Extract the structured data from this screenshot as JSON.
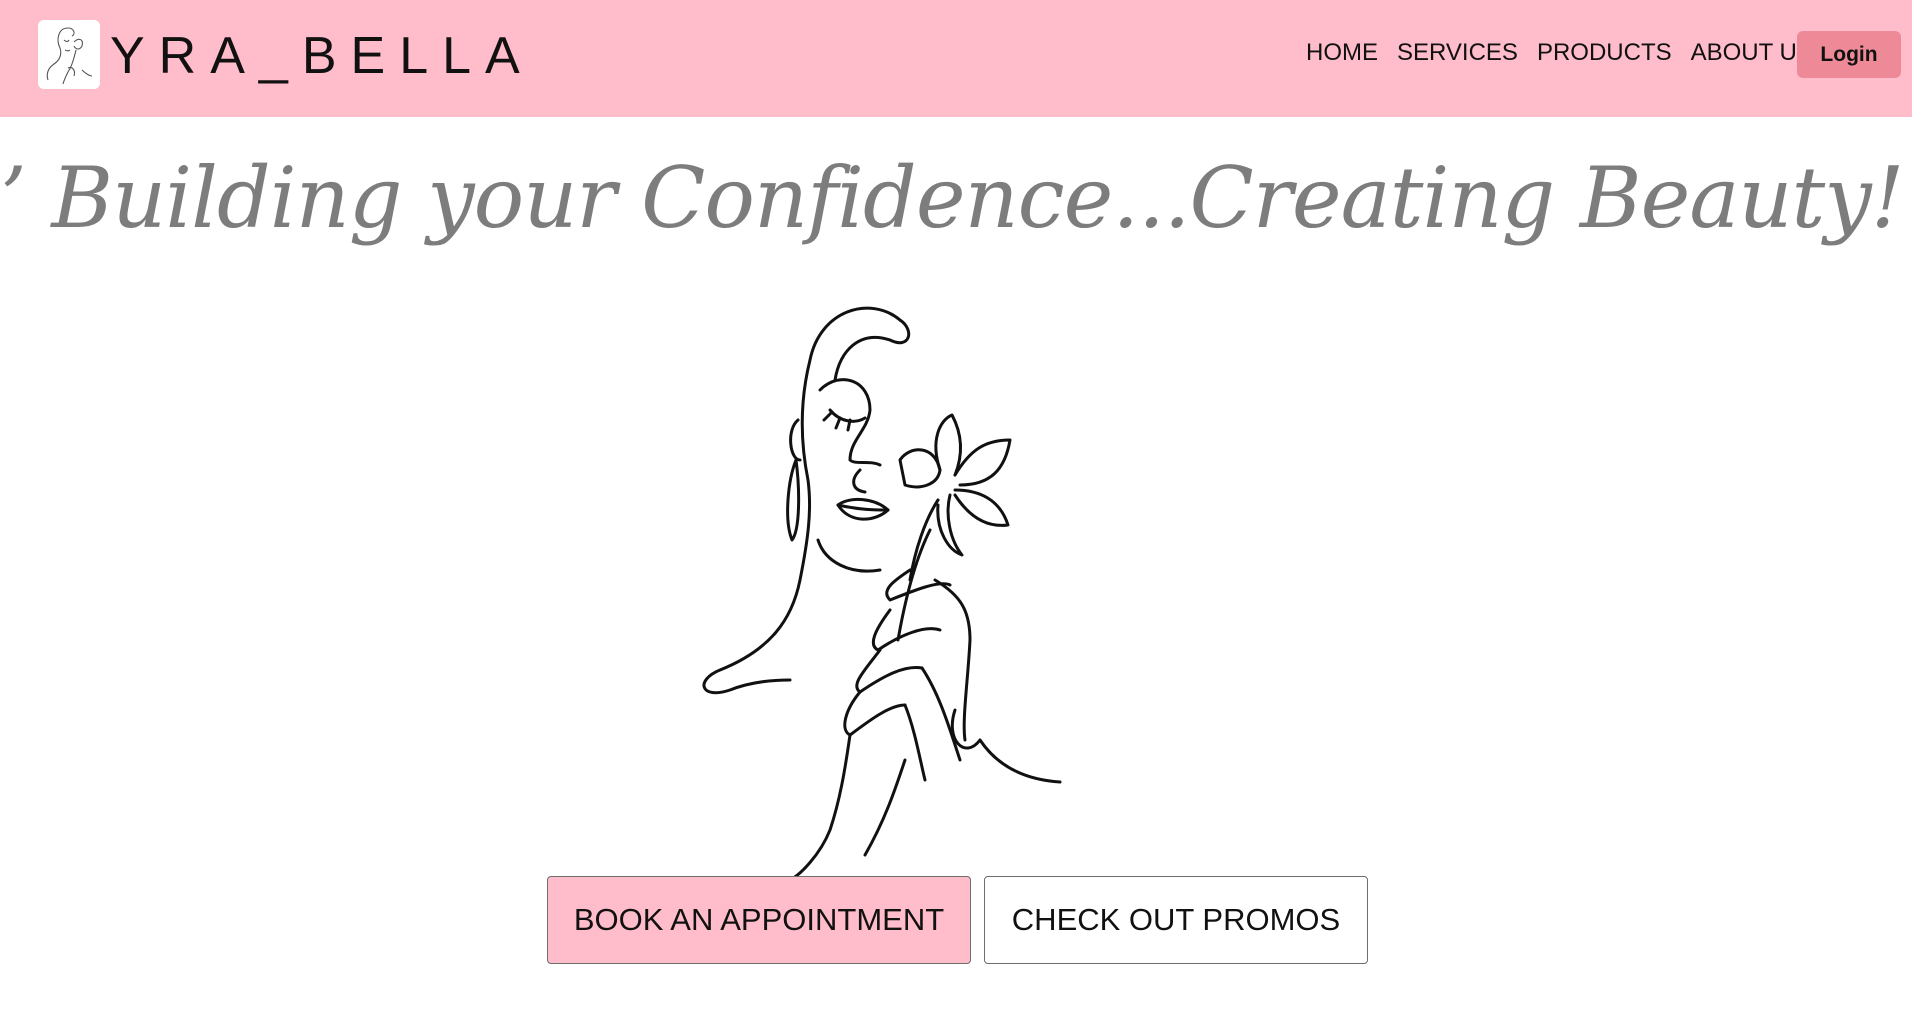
{
  "header": {
    "brand": "YRA_BELLA",
    "logo_icon": "woman-line-art-logo",
    "nav": [
      {
        "label": "HOME"
      },
      {
        "label": "SERVICES"
      },
      {
        "label": "PRODUCTS"
      },
      {
        "label": "ABOUT US"
      }
    ],
    "login_label": "Login",
    "colors": {
      "background": "#ffbcca",
      "login": "#ee8a97"
    }
  },
  "hero": {
    "tagline": "’ Building your Confidence...Creating Beauty! ’",
    "art_icon": "woman-with-flower-line-art",
    "tagline_color": "#7d7d7d"
  },
  "actions": {
    "book_label": "BOOK AN APPOINTMENT",
    "promo_label": "CHECK OUT PROMOS",
    "book_color": "#ffbcca"
  }
}
